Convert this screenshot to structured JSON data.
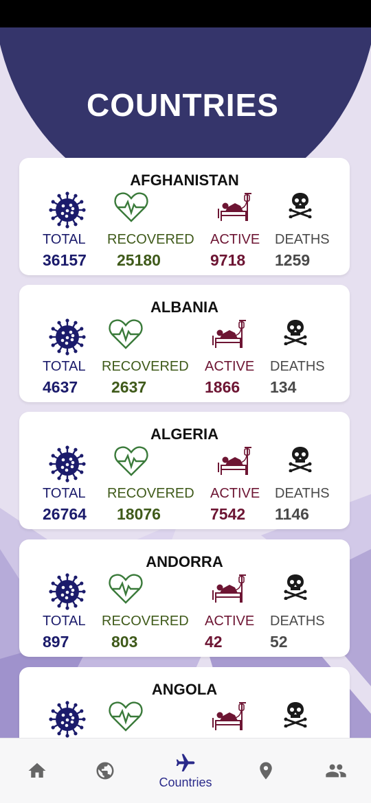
{
  "app": {
    "title": "COUNTRIES"
  },
  "stat_labels": {
    "total": "TOTAL",
    "recovered": "RECOVERED",
    "active": "ACTIVE",
    "deaths": "DEATHS"
  },
  "countries": [
    {
      "name": "AFGHANISTAN",
      "total": "36157",
      "recovered": "25180",
      "active": "9718",
      "deaths": "1259"
    },
    {
      "name": "ALBANIA",
      "total": "4637",
      "recovered": "2637",
      "active": "1866",
      "deaths": "134"
    },
    {
      "name": "ALGERIA",
      "total": "26764",
      "recovered": "18076",
      "active": "7542",
      "deaths": "1146"
    },
    {
      "name": "ANDORRA",
      "total": "897",
      "recovered": "803",
      "active": "42",
      "deaths": "52"
    },
    {
      "name": "ANGOLA",
      "total": "",
      "recovered": "",
      "active": "",
      "deaths": ""
    }
  ],
  "icons": {
    "total": "virus-icon",
    "recovered": "heartbeat-icon",
    "active": "hospital-bed-icon",
    "deaths": "skull-crossbones-icon"
  },
  "bottom_nav": {
    "items": [
      {
        "icon": "home-icon",
        "label": ""
      },
      {
        "icon": "globe-icon",
        "label": ""
      },
      {
        "icon": "airplane-icon",
        "label": "Countries",
        "active": true
      },
      {
        "icon": "location-pin-icon",
        "label": ""
      },
      {
        "icon": "people-icon",
        "label": ""
      }
    ]
  },
  "colors": {
    "header": "#35356b",
    "background": "#e6e0f0",
    "total": "#1b1b6b",
    "recovered": "#3f5a1a",
    "active": "#6d1533",
    "deaths": "#4a4a4a",
    "nav_active": "#2a2a8a",
    "nav_inactive": "#666666"
  }
}
